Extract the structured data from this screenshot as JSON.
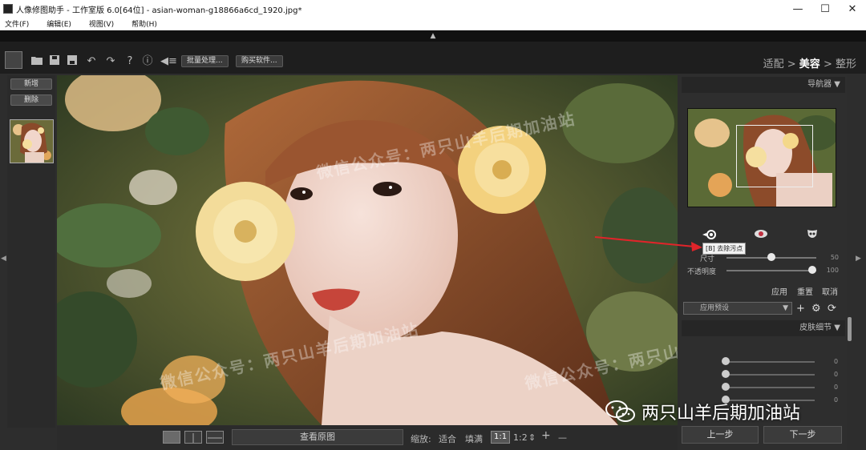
{
  "window": {
    "title": "人像修图助手 - 工作室版 6.0[64位] - asian-woman-g18866a6cd_1920.jpg*"
  },
  "menu": [
    "文件(F)",
    "编辑(E)",
    "视图(V)",
    "帮助(H)"
  ],
  "toolbar": {
    "batch_label": "批量处理...",
    "buy_label": "购买软件...",
    "crumbs": {
      "step1": "适配",
      "sep1": ">",
      "step2": "美容",
      "sep2": ">",
      "step3": "整形"
    }
  },
  "left": {
    "add_label": "新增",
    "delete_label": "删除"
  },
  "watermarks": {
    "text": "微信公众号：两只山羊后期加油站"
  },
  "bottom": {
    "view_original": "查看原图",
    "zoom_label": "缩放:",
    "fit": "适合",
    "fill": "填满",
    "ratio1": "1:1",
    "ratio2": "1:2",
    "plus": "+",
    "minus": "—"
  },
  "right": {
    "navigator_header": "导航器",
    "tooltip": "[B] 去除污点",
    "size_label": "尺寸",
    "size_value": "50",
    "size_level": 0.5,
    "opacity_label": "不透明度",
    "opacity_value": "100",
    "opacity_level": 1.0,
    "apply": "应用",
    "reset": "重置",
    "cancel": "取消",
    "preset_label": "应用预设",
    "skin_header": "皮肤细节",
    "skin_values": [
      "0",
      "0",
      "0",
      "0"
    ],
    "prev_label": "上一步",
    "next_label": "下一步"
  },
  "brand": {
    "text": "两只山羊后期加油站"
  },
  "colors": {
    "accent_red": "#e0242a",
    "panel_bg": "#2e2e2e"
  }
}
